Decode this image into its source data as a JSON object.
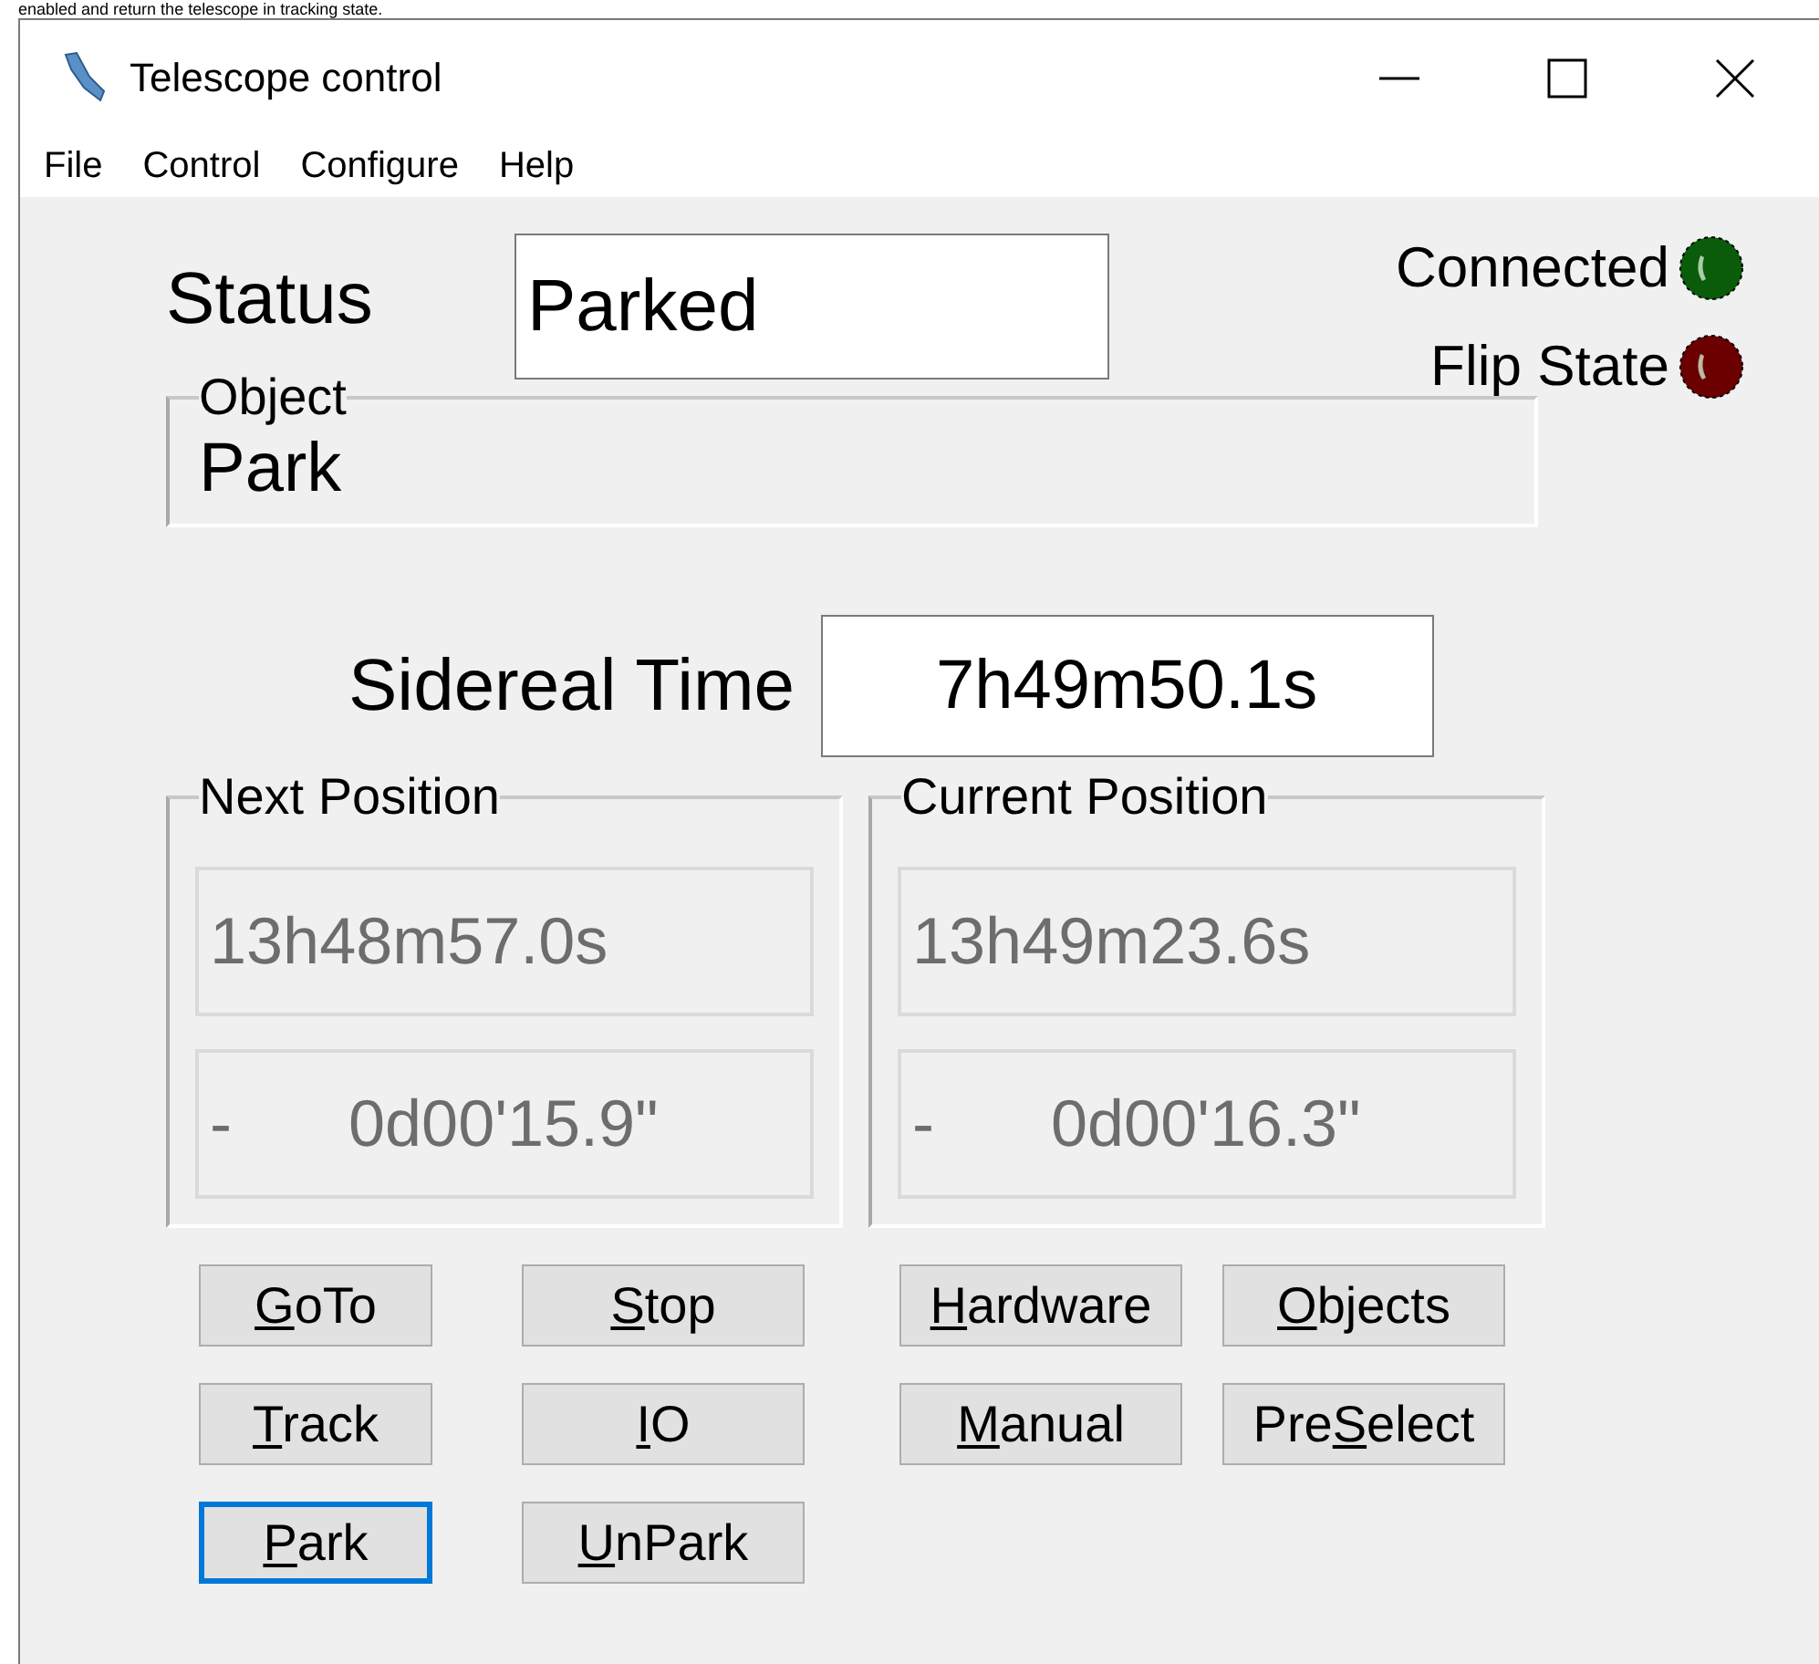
{
  "background_text": "enabled and return the telescope in tracking state.",
  "window": {
    "title": "Telescope control"
  },
  "menu": [
    "File",
    "Control",
    "Configure",
    "Help"
  ],
  "status": {
    "label": "Status",
    "value": "Parked"
  },
  "indicators": [
    {
      "label": "Connected",
      "color": "#0a5c0a"
    },
    {
      "label": "Flip State",
      "color": "#6b0000"
    }
  ],
  "object": {
    "title": "Object",
    "value": "Park"
  },
  "sidereal_time": {
    "label": "Sidereal Time",
    "value": "7h49m50.1s"
  },
  "positions": [
    {
      "title": "Next Position",
      "ra": "13h48m57.0s",
      "dec_sign": "-",
      "dec": "0d00'15.9\""
    },
    {
      "title": "Current Position",
      "ra": "13h49m23.6s",
      "dec_sign": "-",
      "dec": "0d00'16.3\""
    }
  ],
  "button_groups": [
    [
      {
        "access_key": "G",
        "after": "oTo",
        "focused": false
      },
      {
        "access_key": "S",
        "after": "top",
        "focused": false
      },
      {
        "access_key": "T",
        "after": "rack",
        "focused": false
      },
      {
        "access_key": "I",
        "after": "O",
        "focused": false
      },
      {
        "access_key": "P",
        "after": "ark",
        "focused": true
      },
      {
        "access_key": "U",
        "after": "nPark",
        "focused": false
      }
    ],
    [
      {
        "access_key": "H",
        "after": "ardware",
        "focused": false
      },
      {
        "access_key": "O",
        "after": "bjects",
        "focused": false
      },
      {
        "access_key": "M",
        "after": "anual",
        "focused": false
      },
      {
        "before": "Pre",
        "access_key": "S",
        "after": "elect",
        "focused": false
      }
    ]
  ]
}
